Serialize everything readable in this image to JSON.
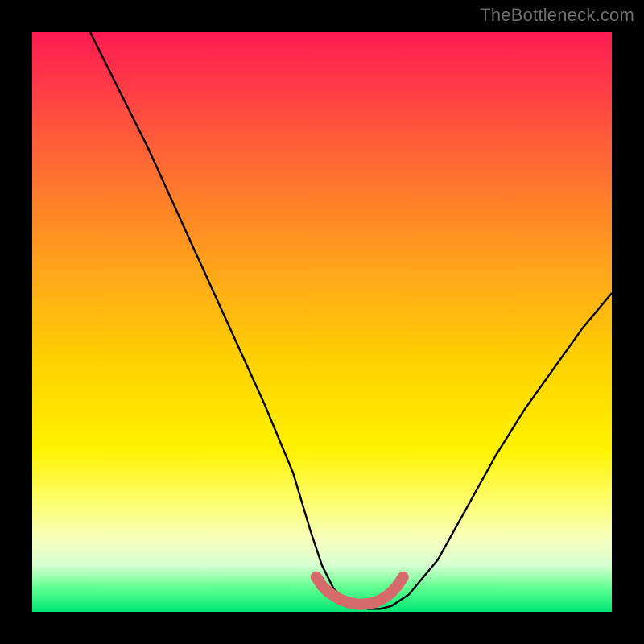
{
  "watermark": "TheBottleneck.com",
  "chart_data": {
    "type": "line",
    "title": "",
    "xlabel": "",
    "ylabel": "",
    "xlim": [
      0,
      100
    ],
    "ylim": [
      0,
      100
    ],
    "series": [
      {
        "name": "bottleneck-curve",
        "color": "#000000",
        "x": [
          10,
          15,
          20,
          25,
          30,
          35,
          40,
          45,
          48,
          50,
          52,
          54,
          56,
          58,
          60,
          62,
          65,
          70,
          75,
          80,
          85,
          90,
          95,
          100
        ],
        "y": [
          100,
          90,
          80,
          69,
          58,
          47,
          36,
          24,
          14,
          8,
          4,
          2,
          1,
          0.5,
          0.5,
          1,
          3,
          9,
          18,
          27,
          35,
          42,
          49,
          55
        ]
      },
      {
        "name": "good-band",
        "color": "#d46a6a",
        "x": [
          49,
          50,
          51,
          52,
          53,
          54,
          55,
          56,
          57,
          58,
          59,
          60,
          61,
          62,
          63,
          64
        ],
        "y": [
          6,
          4.5,
          3.5,
          2.8,
          2.2,
          1.8,
          1.5,
          1.3,
          1.3,
          1.4,
          1.6,
          2.0,
          2.6,
          3.4,
          4.5,
          6
        ]
      }
    ],
    "background_gradient": {
      "top": "#ff1a52",
      "mid": "#fff200",
      "bottom": "#00e676"
    }
  }
}
